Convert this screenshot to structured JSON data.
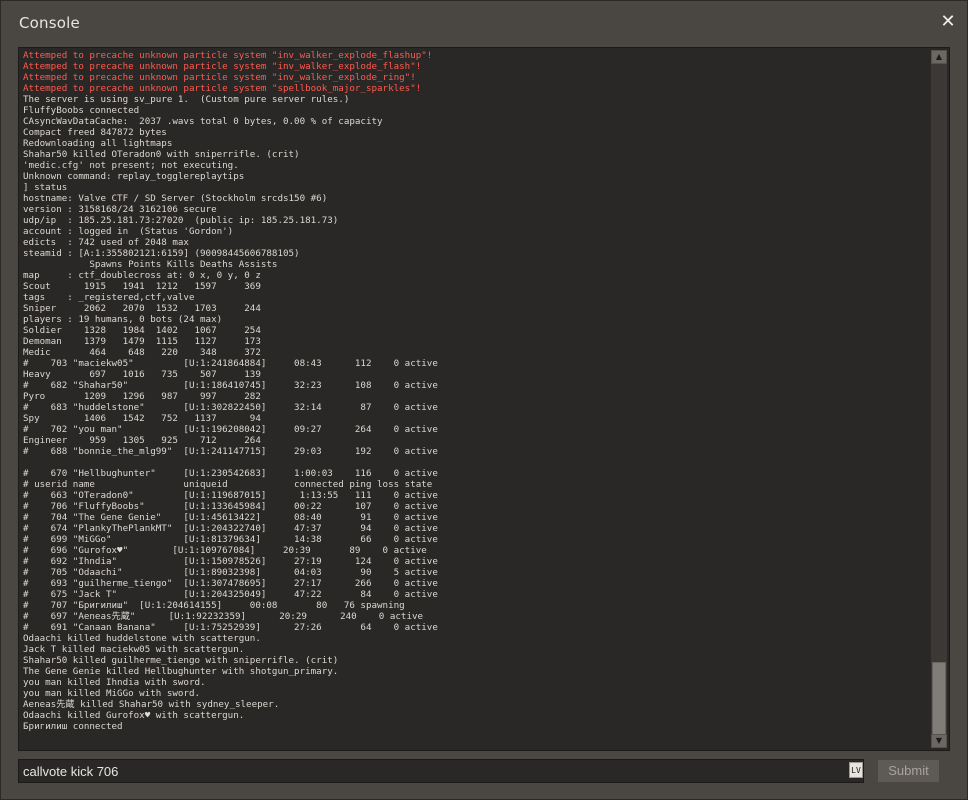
{
  "window": {
    "title": "Console",
    "close_label": "✕"
  },
  "console": {
    "lines": [
      {
        "text": "Attemped to precache unknown particle system \"inv_walker_explode_flashup\"!",
        "type": "error"
      },
      {
        "text": "Attemped to precache unknown particle system \"inv_walker_explode_flash\"!",
        "type": "error"
      },
      {
        "text": "Attemped to precache unknown particle system \"inv_walker_explode_ring\"!",
        "type": "error"
      },
      {
        "text": "Attemped to precache unknown particle system \"spellbook_major_sparkles\"!",
        "type": "error"
      },
      {
        "text": "The server is using sv_pure 1.  (Custom pure server rules.)",
        "type": "normal"
      },
      {
        "text": "FluffyBoobs connected",
        "type": "normal"
      },
      {
        "text": "CAsyncWavDataCache:  2037 .wavs total 0 bytes, 0.00 % of capacity",
        "type": "normal"
      },
      {
        "text": "Compact freed 847872 bytes",
        "type": "normal"
      },
      {
        "text": "Redownloading all lightmaps",
        "type": "normal"
      },
      {
        "text": "Shahar50 killed OTeradon0 with sniperrifle. (crit)",
        "type": "normal"
      },
      {
        "text": "'medic.cfg' not present; not executing.",
        "type": "normal"
      },
      {
        "text": "Unknown command: replay_togglereplaytips",
        "type": "normal"
      },
      {
        "text": "] status",
        "type": "normal"
      },
      {
        "text": "hostname: Valve CTF / SD Server (Stockholm srcds150 #6)",
        "type": "normal"
      },
      {
        "text": "version : 3158168/24 3162106 secure",
        "type": "normal"
      },
      {
        "text": "udp/ip  : 185.25.181.73:27020  (public ip: 185.25.181.73)",
        "type": "normal"
      },
      {
        "text": "account : logged in  (Status 'Gordon')",
        "type": "normal"
      },
      {
        "text": "edicts  : 742 used of 2048 max",
        "type": "normal"
      },
      {
        "text": "steamid : [A:1:3558021​21:6159] (90098445606788105)",
        "type": "normal"
      },
      {
        "text": "            Spawns Points Kills Deaths Assists",
        "type": "normal"
      },
      {
        "text": "map     : ctf_doublecross at: 0 x, 0 y, 0 z",
        "type": "normal"
      },
      {
        "text": "Scout      1915   1941  1212   1597     369",
        "type": "normal"
      },
      {
        "text": "tags    : _registered,ctf,valve",
        "type": "normal"
      },
      {
        "text": "Sniper     2062   2070  1532   1703     244",
        "type": "normal"
      },
      {
        "text": "players : 19 humans, 0 bots (24 max)",
        "type": "normal"
      },
      {
        "text": "Soldier    1328   1984  1402   1067     254",
        "type": "normal"
      },
      {
        "text": "Demoman    1379   1479  1115   1127     173",
        "type": "normal"
      },
      {
        "text": "Medic       464    648   220    348     372",
        "type": "normal"
      },
      {
        "text": "#    703 \"maciekw05\"         [U:1:241864884]     08:43      112    0 active",
        "type": "normal"
      },
      {
        "text": "Heavy       697   1016   735    507     139",
        "type": "normal"
      },
      {
        "text": "#    682 \"Shahar50\"          [U:1:186410745]     32:23      108    0 active",
        "type": "normal"
      },
      {
        "text": "Pyro       1209   1296   987    997     282",
        "type": "normal"
      },
      {
        "text": "#    683 \"huddelstone\"       [U:1:302822450]     32:14       87    0 active",
        "type": "normal"
      },
      {
        "text": "Spy        1406   1542   752   1137      94",
        "type": "normal"
      },
      {
        "text": "#    702 \"you man\"           [U:1:196208042]     09:27      264    0 active",
        "type": "normal"
      },
      {
        "text": "Engineer    959   1305   925    712     264",
        "type": "normal"
      },
      {
        "text": "#    688 \"bonnie_the_mlg99\"  [U:1:241147715]     29:03      192    0 active",
        "type": "normal"
      },
      {
        "text": "",
        "type": "normal"
      },
      {
        "text": "#    670 \"Hellbughunter\"     [U:1:230542683]     1:00:03    116    0 active",
        "type": "normal"
      },
      {
        "text": "# userid name                uniqueid            connected ping loss state",
        "type": "normal"
      },
      {
        "text": "#    663 \"OTeradon0\"         [U:1:119687015]      1:13:55   111    0 active",
        "type": "normal"
      },
      {
        "text": "#    706 \"FluffyBoobs\"       [U:1:133645984]     00:22      107    0 active",
        "type": "normal"
      },
      {
        "text": "#    704 \"The Gene Genie\"    [U:1:45613422]      08:40       91    0 active",
        "type": "normal"
      },
      {
        "text": "#    674 \"PlankyThePlankMT\"  [U:1:204322740]     47:37       94    0 active",
        "type": "normal"
      },
      {
        "text": "#    699 \"MiGGo\"             [U:1:81379634]      14:38       66    0 active",
        "type": "normal"
      },
      {
        "text": "#    696 \"Gurofox♥\"        [U:1:109767084]     20:39       89    0 active",
        "type": "normal"
      },
      {
        "text": "#    692 \"Ihndia\"            [U:1:150978526]     27:19      124    0 active",
        "type": "normal"
      },
      {
        "text": "#    705 \"Odaachi\"           [U:1:89032398]      04:03       90    5 active",
        "type": "normal"
      },
      {
        "text": "#    693 \"guilherme_tiengo\"  [U:1:307478695]     27:17      266    0 active",
        "type": "normal"
      },
      {
        "text": "#    675 \"Jack T\"            [U:1:204325049]     47:22       84    0 active",
        "type": "normal"
      },
      {
        "text": "#    707 \"Бригилиш\"  [U:1:204614155]     00:08       80   76 spawning",
        "type": "normal"
      },
      {
        "text": "#    697 \"Aeneas先蔵\"      [U:1:92232359]      20:29      240    0 active",
        "type": "normal"
      },
      {
        "text": "#    691 \"Canaan Banana\"     [U:1:75252939]      27:26       64    0 active",
        "type": "normal"
      },
      {
        "text": "Odaachi killed huddelstone with scattergun.",
        "type": "normal"
      },
      {
        "text": "Jack T killed maciekw05 with scattergun.",
        "type": "normal"
      },
      {
        "text": "Shahar50 killed guilherme_tiengo with sniperrifle. (crit)",
        "type": "normal"
      },
      {
        "text": "The Gene Genie killed Hellbughunter with shotgun_primary.",
        "type": "normal"
      },
      {
        "text": "you man killed Ihndia with sword.",
        "type": "normal"
      },
      {
        "text": "you man killed MiGGo with sword.",
        "type": "normal"
      },
      {
        "text": "Aeneas先蔵 killed Shahar50 with sydney_sleeper.",
        "type": "normal"
      },
      {
        "text": "Odaachi killed Gurofox♥ with scattergun.",
        "type": "normal"
      },
      {
        "text": "Бригилиш connected",
        "type": "normal"
      }
    ]
  },
  "input": {
    "value": "callvote kick 706",
    "lv_badge": "LV"
  },
  "submit": {
    "label": "Submit"
  },
  "scrollbar": {
    "up_arrow": "▲",
    "down_arrow": "▼"
  },
  "colors": {
    "error_text": "#ff5a4e",
    "normal_text": "#dcd8d2"
  }
}
